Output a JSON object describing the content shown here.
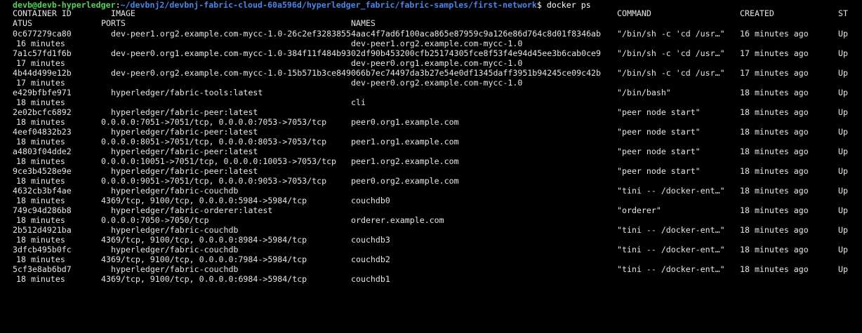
{
  "colors": {
    "background": "#000000",
    "text": "#e6e6e6",
    "prompt_user": "#54d15b",
    "prompt_path": "#4a86e8"
  },
  "prompt": {
    "user_host": "devb@devb-hyperledger",
    "separator": ":",
    "path": "~/devbnj2/devbnj-fabric-cloud-60a596d/hyperledger_fabric/fabric-samples/first-network",
    "symbol": "$",
    "command": "docker ps"
  },
  "headers": {
    "container_id": "CONTAINER ID",
    "image": "IMAGE",
    "command": "COMMAND",
    "created": "CREATED",
    "status_start": "ST",
    "status_end": "ATUS",
    "ports": "PORTS",
    "names": "NAMES"
  },
  "containers": [
    {
      "id": "0c677279ca80",
      "image": "dev-peer1.org2.example.com-mycc-1.0-26c2ef32838554aac4f7ad6f100aca865e87959c9a126e86d764c8d01f8346ab",
      "command": "\"/bin/sh -c 'cd /usr…\"",
      "created": "16 minutes ago",
      "status_start": "Up",
      "status_end": "16 minutes",
      "ports": "",
      "names": "dev-peer1.org2.example.com-mycc-1.0"
    },
    {
      "id": "7a1c57fd1f6b",
      "image": "dev-peer0.org1.example.com-mycc-1.0-384f11f484b9302df90b453200cfb25174305fce8f53f4e94d45ee3b6cab0ce9",
      "command": "\"/bin/sh -c 'cd /usr…\"",
      "created": "17 minutes ago",
      "status_start": "Up",
      "status_end": "17 minutes",
      "ports": "",
      "names": "dev-peer0.org1.example.com-mycc-1.0"
    },
    {
      "id": "4b44d499e12b",
      "image": "dev-peer0.org2.example.com-mycc-1.0-15b571b3ce849066b7ec74497da3b27e54e0df1345daff3951b94245ce09c42b",
      "command": "\"/bin/sh -c 'cd /usr…\"",
      "created": "17 minutes ago",
      "status_start": "Up",
      "status_end": "17 minutes",
      "ports": "",
      "names": "dev-peer0.org2.example.com-mycc-1.0"
    },
    {
      "id": "e429bfbfe971",
      "image": "hyperledger/fabric-tools:latest",
      "command": "\"/bin/bash\"",
      "created": "18 minutes ago",
      "status_start": "Up",
      "status_end": "18 minutes",
      "ports": "",
      "names": "cli"
    },
    {
      "id": "2e02bcfc6892",
      "image": "hyperledger/fabric-peer:latest",
      "command": "\"peer node start\"",
      "created": "18 minutes ago",
      "status_start": "Up",
      "status_end": "18 minutes",
      "ports": "0.0.0.0:7051->7051/tcp, 0.0.0.0:7053->7053/tcp",
      "names": "peer0.org1.example.com"
    },
    {
      "id": "4eef04832b23",
      "image": "hyperledger/fabric-peer:latest",
      "command": "\"peer node start\"",
      "created": "18 minutes ago",
      "status_start": "Up",
      "status_end": "18 minutes",
      "ports": "0.0.0.0:8051->7051/tcp, 0.0.0.0:8053->7053/tcp",
      "names": "peer1.org1.example.com"
    },
    {
      "id": "a4803f04dde2",
      "image": "hyperledger/fabric-peer:latest",
      "command": "\"peer node start\"",
      "created": "18 minutes ago",
      "status_start": "Up",
      "status_end": "18 minutes",
      "ports": "0.0.0.0:10051->7051/tcp, 0.0.0.0:10053->7053/tcp",
      "names": "peer1.org2.example.com"
    },
    {
      "id": "9ce3b4528e9e",
      "image": "hyperledger/fabric-peer:latest",
      "command": "\"peer node start\"",
      "created": "18 minutes ago",
      "status_start": "Up",
      "status_end": "18 minutes",
      "ports": "0.0.0.0:9051->7051/tcp, 0.0.0.0:9053->7053/tcp",
      "names": "peer0.org2.example.com"
    },
    {
      "id": "4632cb3bf4ae",
      "image": "hyperledger/fabric-couchdb",
      "command": "\"tini -- /docker-ent…\"",
      "created": "18 minutes ago",
      "status_start": "Up",
      "status_end": "18 minutes",
      "ports": "4369/tcp, 9100/tcp, 0.0.0.0:5984->5984/tcp",
      "names": "couchdb0"
    },
    {
      "id": "749c94d286b8",
      "image": "hyperledger/fabric-orderer:latest",
      "command": "\"orderer\"",
      "created": "18 minutes ago",
      "status_start": "Up",
      "status_end": "18 minutes",
      "ports": "0.0.0.0:7050->7050/tcp",
      "names": "orderer.example.com"
    },
    {
      "id": "2b512d4921ba",
      "image": "hyperledger/fabric-couchdb",
      "command": "\"tini -- /docker-ent…\"",
      "created": "18 minutes ago",
      "status_start": "Up",
      "status_end": "18 minutes",
      "ports": "4369/tcp, 9100/tcp, 0.0.0.0:8984->5984/tcp",
      "names": "couchdb3"
    },
    {
      "id": "3dfcb495b0fc",
      "image": "hyperledger/fabric-couchdb",
      "command": "\"tini -- /docker-ent…\"",
      "created": "18 minutes ago",
      "status_start": "Up",
      "status_end": "18 minutes",
      "ports": "4369/tcp, 9100/tcp, 0.0.0.0:7984->5984/tcp",
      "names": "couchdb2"
    },
    {
      "id": "5cf3e8ab6bd7",
      "image": "hyperledger/fabric-couchdb",
      "command": "\"tini -- /docker-ent…\"",
      "created": "18 minutes ago",
      "status_start": "Up",
      "status_end": "18 minutes",
      "ports": "4369/tcp, 9100/tcp, 0.0.0.0:6984->5984/tcp",
      "names": "couchdb1"
    }
  ]
}
